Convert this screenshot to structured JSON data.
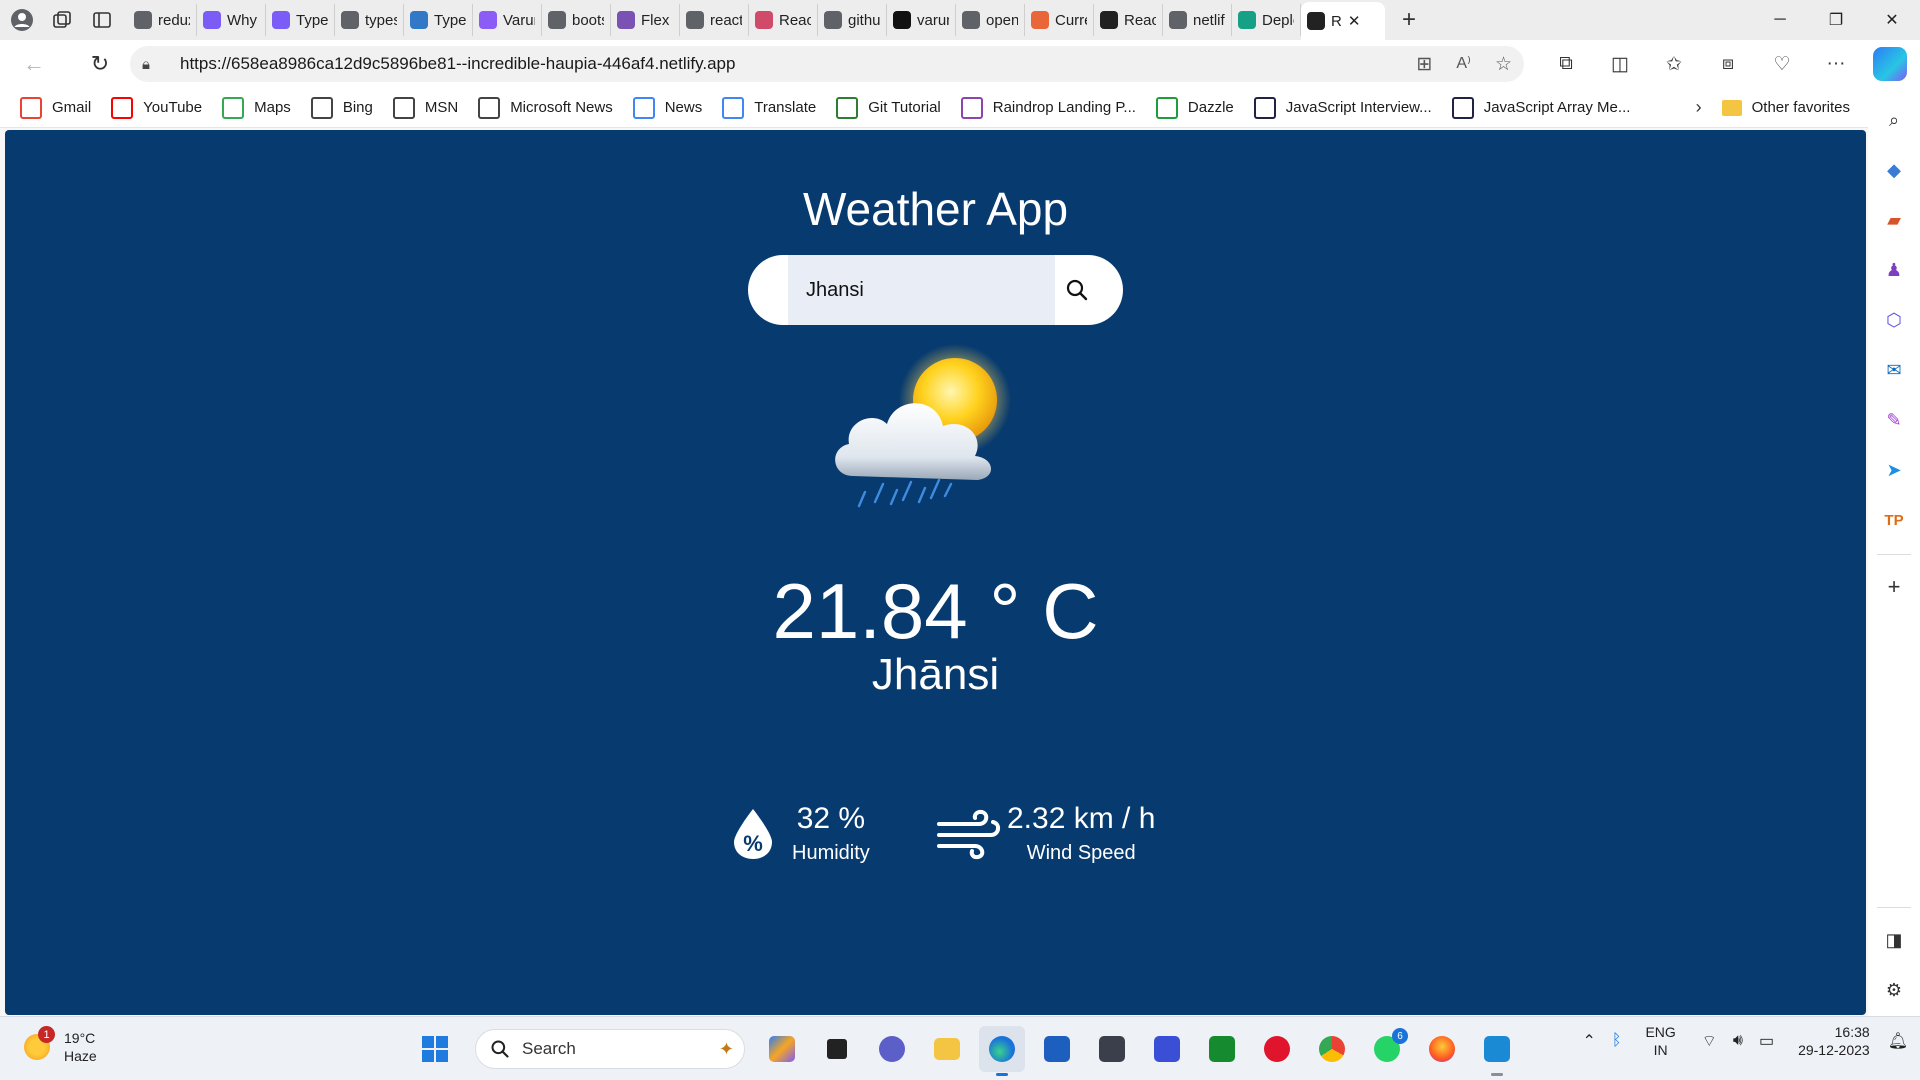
{
  "browser": {
    "tabs": [
      {
        "label": "redux",
        "icon": "search-icon",
        "color": "#5f6368"
      },
      {
        "label": "Why I",
        "icon": "apollo-icon",
        "color": "#7b5cf6"
      },
      {
        "label": "TypeS",
        "icon": "apollo-icon",
        "color": "#7b5cf6"
      },
      {
        "label": "types",
        "icon": "search-icon",
        "color": "#5f6368"
      },
      {
        "label": "TypeS",
        "icon": "typescript-icon",
        "color": "#3178c6"
      },
      {
        "label": "Varun",
        "icon": "vite-icon",
        "color": "#8b5cf6"
      },
      {
        "label": "boots",
        "icon": "search-icon",
        "color": "#5f6368"
      },
      {
        "label": "Flex ·",
        "icon": "bootstrap-icon",
        "color": "#7952b3"
      },
      {
        "label": "react",
        "icon": "search-icon",
        "color": "#5f6368"
      },
      {
        "label": "React",
        "icon": "react-icon",
        "color": "#d04a6a"
      },
      {
        "label": "githu",
        "icon": "search-icon",
        "color": "#5f6368"
      },
      {
        "label": "varun",
        "icon": "github-icon",
        "color": "#111111"
      },
      {
        "label": "open",
        "icon": "search-icon",
        "color": "#5f6368"
      },
      {
        "label": "Curre",
        "icon": "weather-icon",
        "color": "#e9663a"
      },
      {
        "label": "React",
        "icon": "react-icon",
        "color": "#222222"
      },
      {
        "label": "netlif",
        "icon": "search-icon",
        "color": "#5f6368"
      },
      {
        "label": "Deplo",
        "icon": "netlify-icon",
        "color": "#16a085"
      },
      {
        "label": "R",
        "icon": "react-icon",
        "color": "#222222",
        "active": true
      }
    ],
    "url": "https://658ea8986ca12d9c5896be81--incredible-haupia-446af4.netlify.app",
    "favorites": [
      {
        "label": "Gmail",
        "icon": "gmail-icon",
        "color": "#ea4335"
      },
      {
        "label": "YouTube",
        "icon": "youtube-icon",
        "color": "#ff0000"
      },
      {
        "label": "Maps",
        "icon": "maps-icon",
        "color": "#34a853"
      },
      {
        "label": "Bing",
        "icon": "page-icon",
        "color": "#444444"
      },
      {
        "label": "MSN",
        "icon": "page-icon",
        "color": "#444444"
      },
      {
        "label": "Microsoft News",
        "icon": "page-icon",
        "color": "#444444"
      },
      {
        "label": "News",
        "icon": "google-news-icon",
        "color": "#4285f4"
      },
      {
        "label": "Translate",
        "icon": "translate-icon",
        "color": "#4285f4"
      },
      {
        "label": "Git Tutorial",
        "icon": "git-icon",
        "color": "#2e7d32"
      },
      {
        "label": "Raindrop Landing P...",
        "icon": "raindrop-icon",
        "color": "#8e44ad"
      },
      {
        "label": "Dazzle",
        "icon": "dazzle-icon",
        "color": "#1e9e3a"
      },
      {
        "label": "JavaScript Interview...",
        "icon": "javascript-icon",
        "color": "#222244"
      },
      {
        "label": "JavaScript Array Me...",
        "icon": "javascript-icon",
        "color": "#222244"
      }
    ],
    "other_favorites": "Other favorites"
  },
  "app": {
    "title": "Weather App",
    "search_value": "Jhansi",
    "temperature": "21.84 ° C",
    "city": "Jhānsi",
    "humidity": {
      "value": "32 %",
      "label": "Humidity"
    },
    "wind": {
      "value": "2.32 km / h",
      "label": "Wind Speed"
    },
    "background": "#073a6e"
  },
  "taskbar": {
    "weather": {
      "temp": "19°C",
      "condition": "Haze",
      "badge": "1"
    },
    "search_label": "Search",
    "whatsapp_badge": "6",
    "lang_top": "ENG",
    "lang_bottom": "IN",
    "time": "16:38",
    "date": "29-12-2023"
  }
}
